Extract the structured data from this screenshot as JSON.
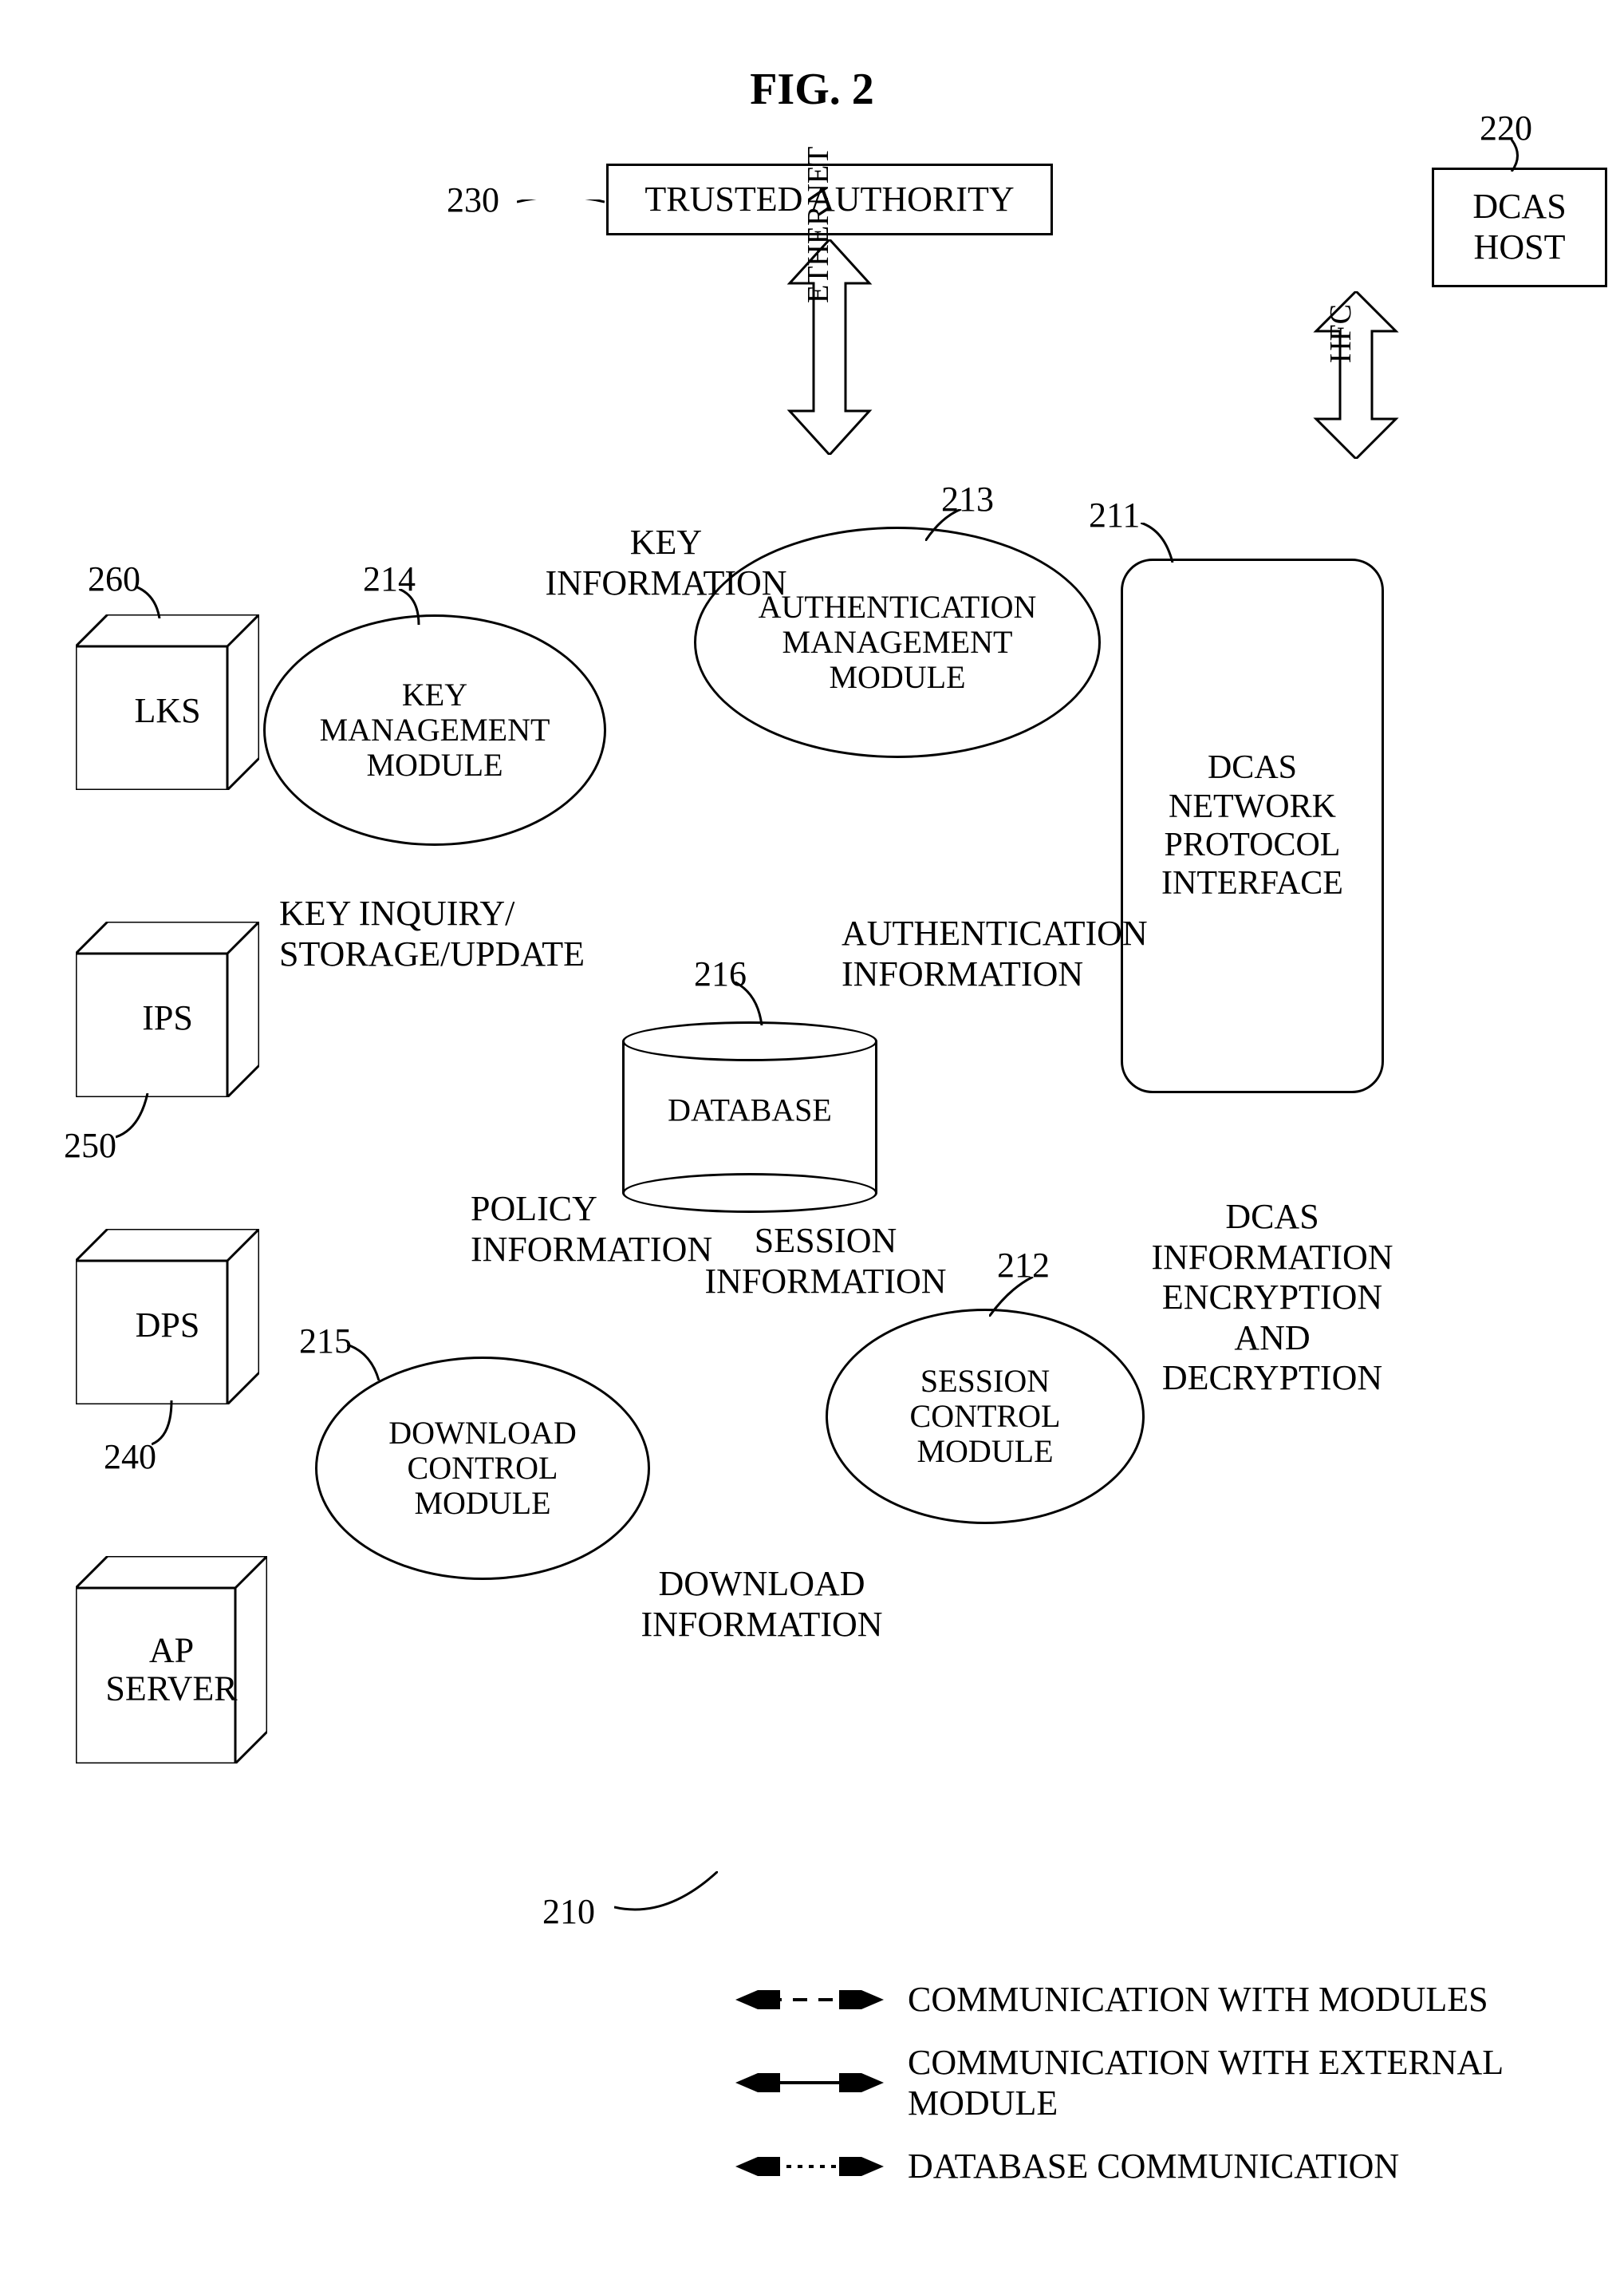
{
  "title": "FIG. 2",
  "chart_data": {
    "type": "diagram",
    "title": "FIG. 2",
    "external_nodes": [
      {
        "id": "230",
        "label": "TRUSTED AUTHORITY",
        "ref": "230",
        "connects_to": "213",
        "link": "ETHERNET",
        "link_type": "external"
      },
      {
        "id": "220",
        "label": "DCAS HOST",
        "ref": "220",
        "connects_to": "211",
        "link": "HFC",
        "link_type": "external"
      },
      {
        "id": "260",
        "label": "LKS",
        "ref": "260",
        "connects_to": "214",
        "link_type": "external"
      },
      {
        "id": "250",
        "label": "IPS",
        "ref": "250",
        "connects_to": "215",
        "link_type": "external"
      },
      {
        "id": "240",
        "label": "DPS",
        "ref": "240",
        "connects_to": "215",
        "link_type": "external"
      },
      {
        "id": "ap",
        "label": "AP SERVER"
      }
    ],
    "platform": {
      "ref": "210"
    },
    "internal_nodes": [
      {
        "id": "211",
        "label": "DCAS NETWORK PROTOCOL INTERFACE",
        "ref": "211",
        "shape": "roundrect"
      },
      {
        "id": "212",
        "label": "SESSION CONTROL MODULE",
        "ref": "212",
        "shape": "ellipse"
      },
      {
        "id": "213",
        "label": "AUTHENTICATION MANAGEMENT MODULE",
        "ref": "213",
        "shape": "ellipse"
      },
      {
        "id": "214",
        "label": "KEY MANAGEMENT MODULE",
        "ref": "214",
        "shape": "ellipse"
      },
      {
        "id": "215",
        "label": "DOWNLOAD CONTROL MODULE",
        "ref": "215",
        "shape": "ellipse"
      },
      {
        "id": "216",
        "label": "DATABASE",
        "ref": "216",
        "shape": "cylinder"
      }
    ],
    "internal_links": [
      {
        "from": "214",
        "to": "213",
        "label": "KEY INFORMATION",
        "type": "module"
      },
      {
        "from": "213",
        "to": "212",
        "label": "AUTHENTICATION INFORMATION",
        "type": "module"
      },
      {
        "from": "215",
        "to": "212",
        "label": "DOWNLOAD INFORMATION",
        "type": "module"
      },
      {
        "from": "212",
        "to": "211",
        "label": "DCAS INFORMATION ENCRYPTION AND DECRYPTION",
        "type": "module"
      },
      {
        "from": "214",
        "to": "216",
        "label": "KEY INQUIRY/ STORAGE/UPDATE",
        "type": "database"
      },
      {
        "from": "215",
        "to": "216",
        "label": "POLICY INFORMATION",
        "type": "database"
      },
      {
        "from": "212",
        "to": "216",
        "label": "SESSION INFORMATION",
        "type": "database"
      }
    ],
    "legend": [
      {
        "style": "dashed-double-arrow",
        "text": "COMMUNICATION WITH MODULES"
      },
      {
        "style": "solid-double-arrow",
        "text": "COMMUNICATION WITH EXTERNAL MODULE"
      },
      {
        "style": "smalldash-double-arrow",
        "text": "DATABASE COMMUNICATION"
      }
    ]
  },
  "nodes": {
    "trusted_authority": "TRUSTED AUTHORITY",
    "dcas_host": "DCAS\nHOST",
    "lks": "LKS",
    "ips": "IPS",
    "dps": "DPS",
    "ap_server": "AP\nSERVER",
    "dcas_npi": "DCAS\nNETWORK\nPROTOCOL\nINTERFACE",
    "session_ctrl": "SESSION\nCONTROL\nMODULE",
    "auth_mgmt": "AUTHENTICATION\nMANAGEMENT\nMODULE",
    "key_mgmt": "KEY\nMANAGEMENT\nMODULE",
    "download_ctrl": "DOWNLOAD\nCONTROL\nMODULE",
    "database": "DATABASE"
  },
  "refs": {
    "r210": "210",
    "r211": "211",
    "r212": "212",
    "r213": "213",
    "r214": "214",
    "r215": "215",
    "r216": "216",
    "r220": "220",
    "r230": "230",
    "r240": "240",
    "r250": "250",
    "r260": "260"
  },
  "linklabels": {
    "ethernet": "ETHERNET",
    "hfc": "HFC",
    "key_info": "KEY\nINFORMATION",
    "auth_info": "AUTHENTICATION\nINFORMATION",
    "download_info": "DOWNLOAD\nINFORMATION",
    "dcas_enc": "DCAS\nINFORMATION\nENCRYPTION\nAND\nDECRYPTION",
    "key_inquiry": "KEY INQUIRY/\nSTORAGE/UPDATE",
    "policy_info": "POLICY\nINFORMATION",
    "session_info": "SESSION\nINFORMATION"
  },
  "legend": {
    "l1": "COMMUNICATION WITH MODULES",
    "l2": "COMMUNICATION WITH EXTERNAL MODULE",
    "l3": "DATABASE COMMUNICATION"
  }
}
